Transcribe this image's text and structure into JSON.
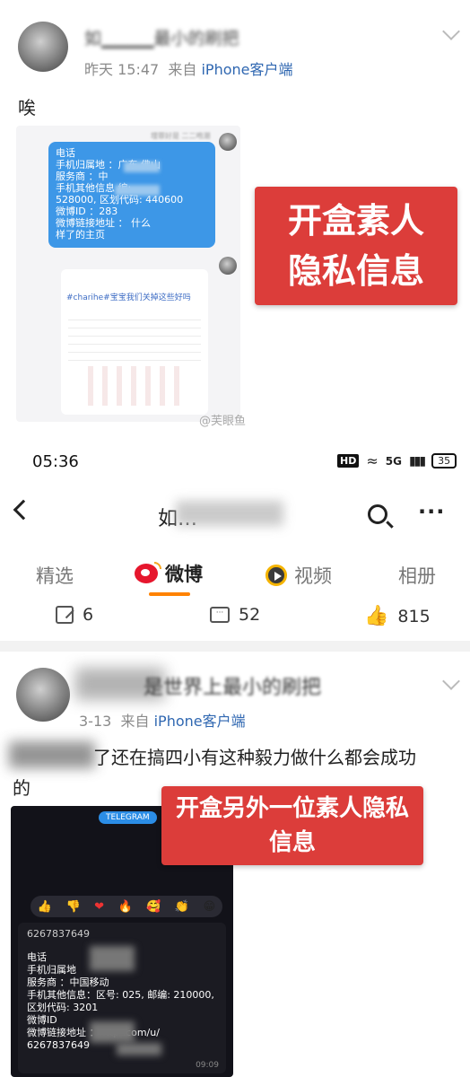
{
  "post1": {
    "author": "如▁▁▁▁最小的刷把",
    "time": "昨天 15:47",
    "source_prefix": "来自",
    "source": "iPhone客户端",
    "body": "唉",
    "overlay": "开盒素人隐私信息",
    "watermark": "@芙眼鱼",
    "chat": {
      "sender": "埋罪好是  二二咆潮",
      "lines": [
        "电话",
        "手机归属地    ：广东 佛山",
        "服务商    ：中",
        "手机其他信息              编:",
        "528000, 区划代码: 440600",
        "微博ID    ：283",
        "微博链接地址    ：              什么",
        "样了的主页"
      ],
      "card_title": "#charihe#宝宝我们关掉这些好吗"
    }
  },
  "status_bar": {
    "time": "05:36",
    "hd": "HD",
    "net": "5G",
    "battery": "35"
  },
  "profile_header": {
    "title": "如…"
  },
  "tabs": [
    {
      "label": "精选",
      "active": false
    },
    {
      "label": "微博",
      "active": true
    },
    {
      "label": "视频",
      "active": false
    },
    {
      "label": "相册",
      "active": false
    }
  ],
  "actions": {
    "reposts": "6",
    "comments": "52",
    "likes": "815"
  },
  "post2": {
    "author": "是世界上最小的刷把",
    "time": "3-13",
    "source_prefix": "来自",
    "source": "iPhone客户端",
    "body_line1": "了还在搞四小有这种毅力做什么都会成功",
    "body_line2": "的",
    "overlay": "开盒另外一位素人隐私信息",
    "telegram": {
      "label": "TELEGRAM",
      "reactions": [
        "👍",
        "👎",
        "❤",
        "🔥",
        "🥰",
        "👏",
        "😁"
      ],
      "number": "6267837649",
      "lines": [
        "电话",
        "手机归属地",
        "服务商    ：中国移动",
        "手机其他信息：区号: 025, 邮编: 210000,",
        "区划代码: 3201",
        "微博ID",
        "微博链接地址    ：http          .com/u/",
        "6267837649"
      ],
      "msg_time": "09:09"
    }
  },
  "colors": {
    "accent_orange": "#ff8200",
    "link_blue": "#2f67b1",
    "overlay_red": "#dc3d3a",
    "bubble_blue": "#3d97e7"
  }
}
